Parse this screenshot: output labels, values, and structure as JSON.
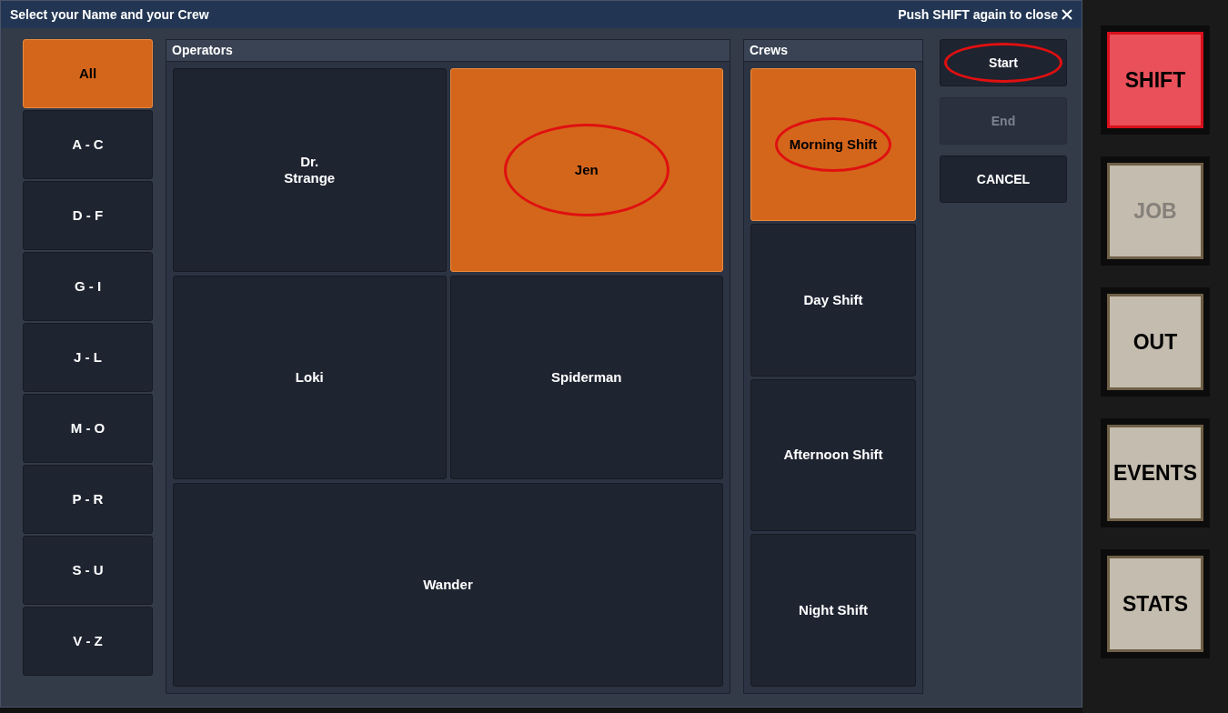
{
  "dialog": {
    "title": "Select your Name and your Crew",
    "close_hint": "Push SHIFT again to close"
  },
  "letter_filters": [
    {
      "label": "All",
      "selected": true
    },
    {
      "label": "A - C",
      "selected": false
    },
    {
      "label": "D - F",
      "selected": false
    },
    {
      "label": "G - I",
      "selected": false
    },
    {
      "label": "J - L",
      "selected": false
    },
    {
      "label": "M - O",
      "selected": false
    },
    {
      "label": "P - R",
      "selected": false
    },
    {
      "label": "S - U",
      "selected": false
    },
    {
      "label": "V - Z",
      "selected": false
    }
  ],
  "operators": {
    "title": "Operators",
    "items": [
      {
        "label": "Dr.\nStrange",
        "selected": false,
        "circled": false
      },
      {
        "label": "Jen",
        "selected": true,
        "circled": true
      },
      {
        "label": "Loki",
        "selected": false,
        "circled": false
      },
      {
        "label": "Spiderman",
        "selected": false,
        "circled": false
      },
      {
        "label": "Wander",
        "selected": false,
        "circled": false
      }
    ]
  },
  "crews": {
    "title": "Crews",
    "items": [
      {
        "label": "Morning Shift",
        "selected": true,
        "circled": true
      },
      {
        "label": "Day Shift",
        "selected": false,
        "circled": false
      },
      {
        "label": "Afternoon Shift",
        "selected": false,
        "circled": false
      },
      {
        "label": "Night Shift",
        "selected": false,
        "circled": false
      }
    ]
  },
  "actions": [
    {
      "label": "Start",
      "disabled": false,
      "circled": true
    },
    {
      "label": "End",
      "disabled": true,
      "circled": false
    },
    {
      "label": "CANCEL",
      "disabled": false,
      "circled": false
    }
  ],
  "hard_keys": [
    {
      "label": "SHIFT",
      "active": true,
      "disabled": false
    },
    {
      "label": "JOB",
      "active": false,
      "disabled": true
    },
    {
      "label": "OUT",
      "active": false,
      "disabled": false
    },
    {
      "label": "EVENTS",
      "active": false,
      "disabled": false
    },
    {
      "label": "STATS",
      "active": false,
      "disabled": false
    }
  ]
}
